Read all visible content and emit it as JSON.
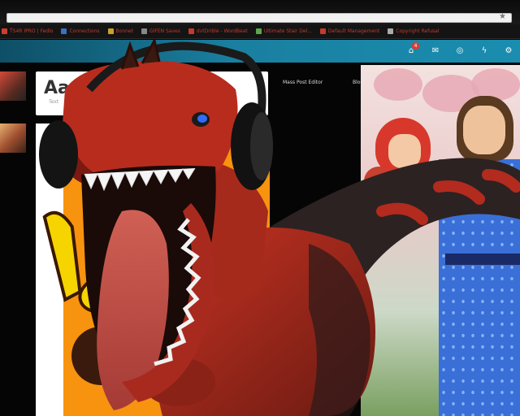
{
  "browser": {
    "bookmarks": [
      {
        "label": "T̈S4R IPRO | Fedlo",
        "color": "#d23c2c"
      },
      {
        "label": "Connections",
        "color": "#3b6fc4"
      },
      {
        "label": "Bonnet",
        "color": "#c9a227"
      },
      {
        "label": "GIFEN Saves",
        "color": "#888888"
      },
      {
        "label": "dvtDrible - WordBeat",
        "color": "#c53a2c"
      },
      {
        "label": "Ultimate Stair Del...",
        "color": "#5aa84a"
      },
      {
        "label": "Default Management",
        "color": "#c53a2c"
      },
      {
        "label": "Copyright Refusal",
        "color": "#aaaaaa"
      }
    ]
  },
  "header": {
    "notification_count": "4",
    "icons": [
      "home-icon",
      "mail-icon",
      "globe-icon",
      "bolt-icon",
      "gear-icon"
    ]
  },
  "content": {
    "font_preview": "Aa",
    "font_preview_sub": "Text",
    "nav_links": [
      "Mass Post Editor",
      "Blog"
    ]
  },
  "colors": {
    "header_accent": "#1a8db0",
    "orange_panel": "#f7930f",
    "dino_red": "#b32a1e",
    "dino_dark": "#2a1a1a"
  }
}
